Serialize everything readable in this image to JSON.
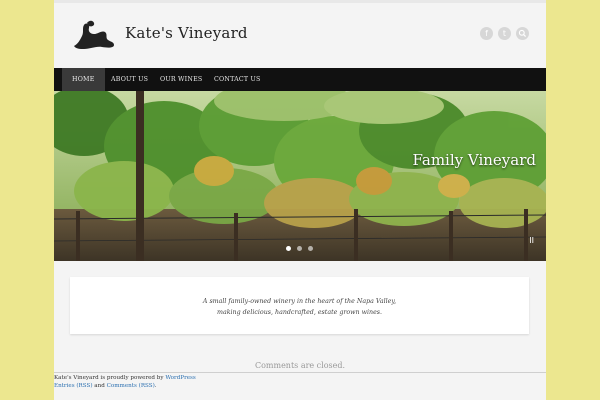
{
  "site": {
    "title": "Kate's Vineyard"
  },
  "header": {
    "social_icons": [
      "facebook-icon",
      "twitter-icon",
      "search-icon"
    ]
  },
  "nav": {
    "items": [
      "HOME",
      "ABOUT US",
      "OUR WINES",
      "CONTACT US"
    ],
    "active": "HOME"
  },
  "slider": {
    "caption": "Family Vineyard",
    "slide_count": 3,
    "active_slide": 1
  },
  "intro": {
    "line1": "A small family-owned winery in the heart of the Napa Valley,",
    "line2": "making delicious, handcrafted, estate grown wines."
  },
  "comments_text": "Comments are closed.",
  "footer": {
    "powered_prefix": "Kate's Vineyard is proudly powered by ",
    "powered_link": "WordPress",
    "entries_link": "Entries (RSS)",
    "and_text": " and ",
    "comments_link": "Comments (RSS)",
    "period": "."
  },
  "colors": {
    "background": "#ece78f",
    "nav": "#111111",
    "link": "#2a6fb0"
  }
}
